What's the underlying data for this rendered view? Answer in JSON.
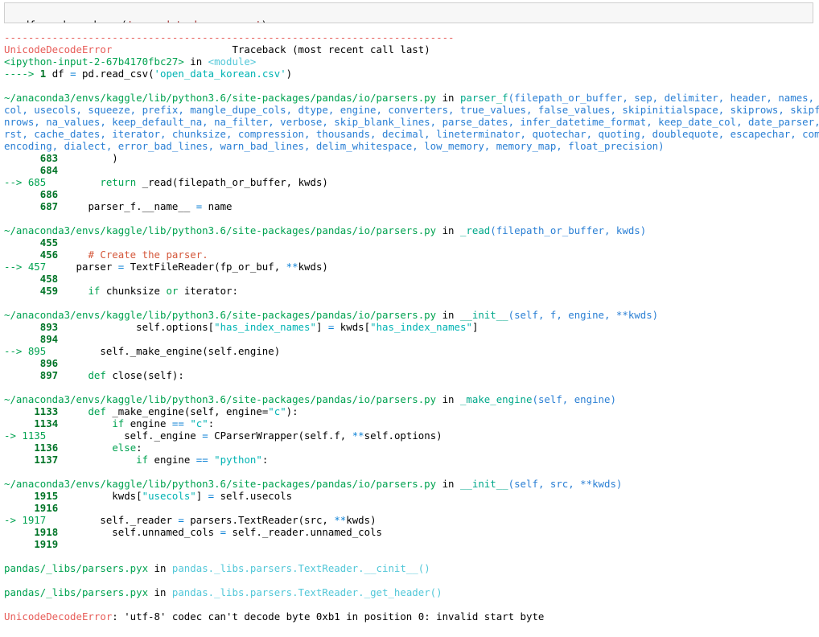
{
  "input_cell": {
    "name": "code-input-cell",
    "tokens": [
      {
        "t": "df ",
        "c": "black"
      },
      {
        "t": "=",
        "c": "magenta"
      },
      {
        "t": " pd.read_csv(",
        "c": "black"
      },
      {
        "t": "'open_data_korean.csv'",
        "c": "darkred"
      },
      {
        "t": ")",
        "c": "black"
      }
    ]
  },
  "traceback": {
    "error_type": "UnicodeDecodeError",
    "error_message": "'utf-8' codec can't decode byte 0xb1 in position 0: invalid start byte",
    "traceback_header": "Traceback (most recent call last)",
    "rule": "---------------------------------------------------------------------------",
    "lines": [
      {
        "type": "rule",
        "text": "---------------------------------------------------------------------------",
        "color": "red"
      },
      {
        "type": "header",
        "error": "UnicodeDecodeError",
        "header": "Traceback (most recent call last)"
      },
      {
        "type": "frame",
        "path": "<ipython-input-2-67b4170fbc27>",
        "in": " in ",
        "func": "<module>",
        "func_color": "cyan",
        "args": ""
      },
      {
        "type": "code",
        "marker": "----> ",
        "lineno": "1",
        "tokens": [
          {
            "t": "df ",
            "c": "black"
          },
          {
            "t": "=",
            "c": "op"
          },
          {
            "t": " pd.read_csv(",
            "c": "black"
          },
          {
            "t": "'open_data_korean.csv'",
            "c": "teal"
          },
          {
            "t": ")",
            "c": "black"
          }
        ]
      },
      {
        "type": "blank"
      },
      {
        "type": "frame",
        "path": "~/anaconda3/envs/kaggle/lib/python3.6/site-packages/pandas/io/parsers.py",
        "in": " in ",
        "func": "parser_f",
        "func_color": "func",
        "args": "(filepath_or_buffer, sep, delimiter, header, names, index_"
      },
      {
        "type": "sig",
        "text": "col, usecols, squeeze, prefix, mangle_dupe_cols, dtype, engine, converters, true_values, false_values, skipinitialspace, skiprows, skipfooter,"
      },
      {
        "type": "sig",
        "text": "nrows, na_values, keep_default_na, na_filter, verbose, skip_blank_lines, parse_dates, infer_datetime_format, keep_date_col, date_parser, dayfi"
      },
      {
        "type": "sig",
        "text": "rst, cache_dates, iterator, chunksize, compression, thousands, decimal, lineterminator, quotechar, quoting, doublequote, escapechar, comment,"
      },
      {
        "type": "sig",
        "text": "encoding, dialect, error_bad_lines, warn_bad_lines, delim_whitespace, low_memory, memory_map, float_precision)"
      },
      {
        "type": "code",
        "marker": "      ",
        "lineno": "683",
        "tokens": [
          {
            "t": "        )",
            "c": "black"
          }
        ]
      },
      {
        "type": "code",
        "marker": "      ",
        "lineno": "684",
        "tokens": [
          {
            "t": "",
            "c": "black"
          }
        ]
      },
      {
        "type": "code",
        "marker": "--> ",
        "lineno": "685",
        "highlight": true,
        "tokens": [
          {
            "t": "        ",
            "c": "black"
          },
          {
            "t": "return",
            "c": "green"
          },
          {
            "t": " _read(filepath_or_buffer, kwds)",
            "c": "black"
          }
        ]
      },
      {
        "type": "code",
        "marker": "      ",
        "lineno": "686",
        "tokens": [
          {
            "t": "",
            "c": "black"
          }
        ]
      },
      {
        "type": "code",
        "marker": "      ",
        "lineno": "687",
        "tokens": [
          {
            "t": "    parser_f.__name__ ",
            "c": "black"
          },
          {
            "t": "=",
            "c": "op"
          },
          {
            "t": " name",
            "c": "black"
          }
        ]
      },
      {
        "type": "blank"
      },
      {
        "type": "frame",
        "path": "~/anaconda3/envs/kaggle/lib/python3.6/site-packages/pandas/io/parsers.py",
        "in": " in ",
        "func": "_read",
        "func_color": "func",
        "args": "(filepath_or_buffer, kwds)"
      },
      {
        "type": "code",
        "marker": "      ",
        "lineno": "455",
        "tokens": [
          {
            "t": "",
            "c": "black"
          }
        ]
      },
      {
        "type": "code",
        "marker": "      ",
        "lineno": "456",
        "tokens": [
          {
            "t": "    ",
            "c": "black"
          },
          {
            "t": "# Create the parser.",
            "c": "comment"
          }
        ]
      },
      {
        "type": "code",
        "marker": "--> ",
        "lineno": "457",
        "highlight": true,
        "tokens": [
          {
            "t": "    parser ",
            "c": "black"
          },
          {
            "t": "=",
            "c": "op"
          },
          {
            "t": " TextFileReader(fp_or_buf, ",
            "c": "black"
          },
          {
            "t": "**",
            "c": "op"
          },
          {
            "t": "kwds)",
            "c": "black"
          }
        ]
      },
      {
        "type": "code",
        "marker": "      ",
        "lineno": "458",
        "tokens": [
          {
            "t": "",
            "c": "black"
          }
        ]
      },
      {
        "type": "code",
        "marker": "      ",
        "lineno": "459",
        "tokens": [
          {
            "t": "    ",
            "c": "black"
          },
          {
            "t": "if",
            "c": "green"
          },
          {
            "t": " chunksize ",
            "c": "black"
          },
          {
            "t": "or",
            "c": "green"
          },
          {
            "t": " iterator:",
            "c": "black"
          }
        ]
      },
      {
        "type": "blank"
      },
      {
        "type": "frame",
        "path": "~/anaconda3/envs/kaggle/lib/python3.6/site-packages/pandas/io/parsers.py",
        "in": " in ",
        "func": "__init__",
        "func_color": "func",
        "args": "(self, f, engine, **kwds)"
      },
      {
        "type": "code",
        "marker": "      ",
        "lineno": "893",
        "tokens": [
          {
            "t": "            self.options[",
            "c": "black"
          },
          {
            "t": "\"has_index_names\"",
            "c": "teal"
          },
          {
            "t": "] ",
            "c": "black"
          },
          {
            "t": "=",
            "c": "op"
          },
          {
            "t": " kwds[",
            "c": "black"
          },
          {
            "t": "\"has_index_names\"",
            "c": "teal"
          },
          {
            "t": "]",
            "c": "black"
          }
        ]
      },
      {
        "type": "code",
        "marker": "      ",
        "lineno": "894",
        "tokens": [
          {
            "t": "",
            "c": "black"
          }
        ]
      },
      {
        "type": "code",
        "marker": "--> ",
        "lineno": "895",
        "highlight": true,
        "tokens": [
          {
            "t": "        self._make_engine(self.engine)",
            "c": "black"
          }
        ]
      },
      {
        "type": "code",
        "marker": "      ",
        "lineno": "896",
        "tokens": [
          {
            "t": "",
            "c": "black"
          }
        ]
      },
      {
        "type": "code",
        "marker": "      ",
        "lineno": "897",
        "tokens": [
          {
            "t": "    ",
            "c": "black"
          },
          {
            "t": "def",
            "c": "green"
          },
          {
            "t": " close(self):",
            "c": "black"
          }
        ]
      },
      {
        "type": "blank"
      },
      {
        "type": "frame",
        "path": "~/anaconda3/envs/kaggle/lib/python3.6/site-packages/pandas/io/parsers.py",
        "in": " in ",
        "func": "_make_engine",
        "func_color": "func",
        "args": "(self, engine)"
      },
      {
        "type": "code",
        "marker": "     ",
        "lineno": "1133",
        "tokens": [
          {
            "t": "    ",
            "c": "black"
          },
          {
            "t": "def",
            "c": "green"
          },
          {
            "t": " _make_engine(self, engine=",
            "c": "black"
          },
          {
            "t": "\"c\"",
            "c": "teal"
          },
          {
            "t": "):",
            "c": "black"
          }
        ]
      },
      {
        "type": "code",
        "marker": "     ",
        "lineno": "1134",
        "tokens": [
          {
            "t": "        ",
            "c": "black"
          },
          {
            "t": "if",
            "c": "green"
          },
          {
            "t": " engine ",
            "c": "black"
          },
          {
            "t": "==",
            "c": "op"
          },
          {
            "t": " ",
            "c": "black"
          },
          {
            "t": "\"c\"",
            "c": "teal"
          },
          {
            "t": ":",
            "c": "black"
          }
        ]
      },
      {
        "type": "code",
        "marker": "-> ",
        "lineno": "1135",
        "highlight": true,
        "tokens": [
          {
            "t": "            self._engine ",
            "c": "black"
          },
          {
            "t": "=",
            "c": "op"
          },
          {
            "t": " CParserWrapper(self.f, ",
            "c": "black"
          },
          {
            "t": "**",
            "c": "op"
          },
          {
            "t": "self.options)",
            "c": "black"
          }
        ]
      },
      {
        "type": "code",
        "marker": "     ",
        "lineno": "1136",
        "tokens": [
          {
            "t": "        ",
            "c": "black"
          },
          {
            "t": "else",
            "c": "green"
          },
          {
            "t": ":",
            "c": "black"
          }
        ]
      },
      {
        "type": "code",
        "marker": "     ",
        "lineno": "1137",
        "tokens": [
          {
            "t": "            ",
            "c": "black"
          },
          {
            "t": "if",
            "c": "green"
          },
          {
            "t": " engine ",
            "c": "black"
          },
          {
            "t": "==",
            "c": "op"
          },
          {
            "t": " ",
            "c": "black"
          },
          {
            "t": "\"python\"",
            "c": "teal"
          },
          {
            "t": ":",
            "c": "black"
          }
        ]
      },
      {
        "type": "blank"
      },
      {
        "type": "frame",
        "path": "~/anaconda3/envs/kaggle/lib/python3.6/site-packages/pandas/io/parsers.py",
        "in": " in ",
        "func": "__init__",
        "func_color": "func",
        "args": "(self, src, **kwds)"
      },
      {
        "type": "code",
        "marker": "     ",
        "lineno": "1915",
        "tokens": [
          {
            "t": "        kwds[",
            "c": "black"
          },
          {
            "t": "\"usecols\"",
            "c": "teal"
          },
          {
            "t": "] ",
            "c": "black"
          },
          {
            "t": "=",
            "c": "op"
          },
          {
            "t": " self.usecols",
            "c": "black"
          }
        ]
      },
      {
        "type": "code",
        "marker": "     ",
        "lineno": "1916",
        "tokens": [
          {
            "t": "",
            "c": "black"
          }
        ]
      },
      {
        "type": "code",
        "marker": "-> ",
        "lineno": "1917",
        "highlight": true,
        "tokens": [
          {
            "t": "        self._reader ",
            "c": "black"
          },
          {
            "t": "=",
            "c": "op"
          },
          {
            "t": " parsers.TextReader(src, ",
            "c": "black"
          },
          {
            "t": "**",
            "c": "op"
          },
          {
            "t": "kwds)",
            "c": "black"
          }
        ]
      },
      {
        "type": "code",
        "marker": "     ",
        "lineno": "1918",
        "tokens": [
          {
            "t": "        self.unnamed_cols ",
            "c": "black"
          },
          {
            "t": "=",
            "c": "op"
          },
          {
            "t": " self._reader.unnamed_cols",
            "c": "black"
          }
        ]
      },
      {
        "type": "code",
        "marker": "     ",
        "lineno": "1919",
        "tokens": [
          {
            "t": "",
            "c": "black"
          }
        ]
      },
      {
        "type": "blank"
      },
      {
        "type": "frame",
        "path": "pandas/_libs/parsers.pyx",
        "in": " in ",
        "func": "pandas._libs.parsers.TextReader.__cinit__()",
        "func_color": "cyan",
        "args": ""
      },
      {
        "type": "blank"
      },
      {
        "type": "frame",
        "path": "pandas/_libs/parsers.pyx",
        "in": " in ",
        "func": "pandas._libs.parsers.TextReader._get_header()",
        "func_color": "cyan",
        "args": ""
      },
      {
        "type": "blank"
      },
      {
        "type": "error",
        "name": "UnicodeDecodeError",
        "message": ": 'utf-8' codec can't decode byte 0xb1 in position 0: invalid start byte"
      }
    ]
  },
  "colors": {
    "error_red": "#e75c58",
    "path_green": "#00a250",
    "lineno_green": "#007427",
    "arg_blue": "#2a7fd4",
    "qualname_cyan": "#52c7d8",
    "string_teal": "#00b3b3",
    "comment_orange": "#d4573a",
    "input_string_darkred": "#9b1d1d",
    "input_bg": "#f7f7f7",
    "input_border": "#cfcfcf"
  }
}
